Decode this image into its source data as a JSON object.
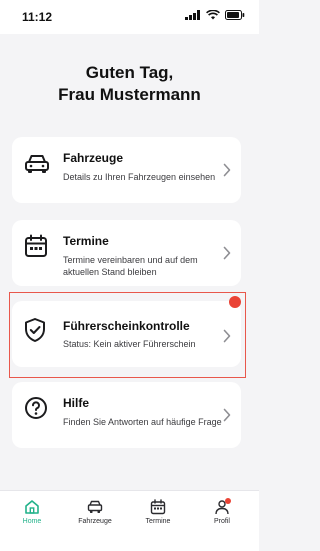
{
  "status_bar": {
    "time": "11:12"
  },
  "greeting": {
    "line1": "Guten Tag,",
    "line2": "Frau Mustermann"
  },
  "cards": [
    {
      "title": "Fahrzeuge",
      "description": "Details zu Ihren Fahrzeugen einsehen",
      "icon": "car-icon"
    },
    {
      "title": "Termine",
      "description": "Termine vereinbaren und auf dem aktuellen Stand bleiben",
      "icon": "calendar-icon"
    },
    {
      "title": "Führerscheinkontrolle",
      "description": "Status: Kein aktiver Führerschein",
      "icon": "shield-check-icon"
    },
    {
      "title": "Hilfe",
      "description": "Finden Sie Antworten auf häufige Frage",
      "icon": "help-icon"
    }
  ],
  "tabs": [
    {
      "label": "Home",
      "icon": "home-icon",
      "active": true
    },
    {
      "label": "Fahrzeuge",
      "icon": "car-icon",
      "active": false
    },
    {
      "label": "Termine",
      "icon": "calendar-icon",
      "active": false
    },
    {
      "label": "Profil",
      "icon": "profile-icon",
      "active": false
    }
  ],
  "colors": {
    "accent": "#22b28a",
    "alert": "#ea4335",
    "highlight_border": "#e8574b",
    "background": "#f4f4f6"
  }
}
